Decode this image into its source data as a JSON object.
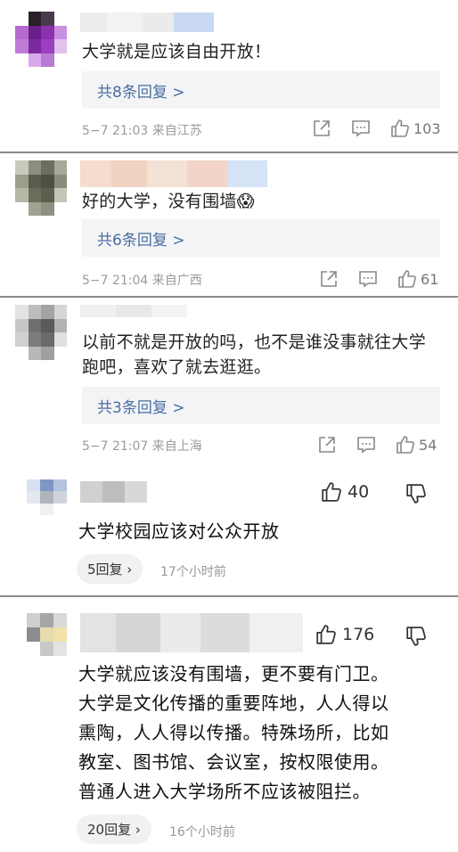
{
  "comments": [
    {
      "text": "大学就是应该自由开放！",
      "replies": "共8条回复 >",
      "meta": "5−7 21:03 来自江苏",
      "likes": "103"
    },
    {
      "text": "好的大学，没有围墙😱",
      "replies": "共6条回复 >",
      "meta": "5−7 21:04 来自广西",
      "likes": "61"
    },
    {
      "text_line1": "以前不就是开放的吗，也不是谁没事就往大学",
      "text_line2": "跑吧，喜欢了就去逛逛。",
      "replies": "共3条回复 >",
      "meta": "5−7 21:07 来自上海",
      "likes": "54"
    }
  ],
  "comments2": [
    {
      "likes": "40",
      "text": "大学校园应该对公众开放",
      "replies": "5回复 ›",
      "time": "17个小时前"
    },
    {
      "likes": "176",
      "lines": [
        "大学就应该没有围墙，更不要有门卫。",
        "大学是文化传播的重要阵地，人人得以",
        "熏陶，人人得以传播。特殊场所，比如",
        "教室、图书馆、会议室，按权限使用。",
        "普通人进入大学场所不应该被阻拦。"
      ],
      "replies": "20回复 ›",
      "time": "16个小时前"
    }
  ],
  "icons": [
    "share-icon",
    "comment-icon",
    "thumbs-up-icon",
    "thumbs-down-icon"
  ],
  "colors": {
    "reply_link": "#4a6ea3",
    "reply_bg": "#f4f4f6",
    "divider": "#8a8a8a"
  }
}
